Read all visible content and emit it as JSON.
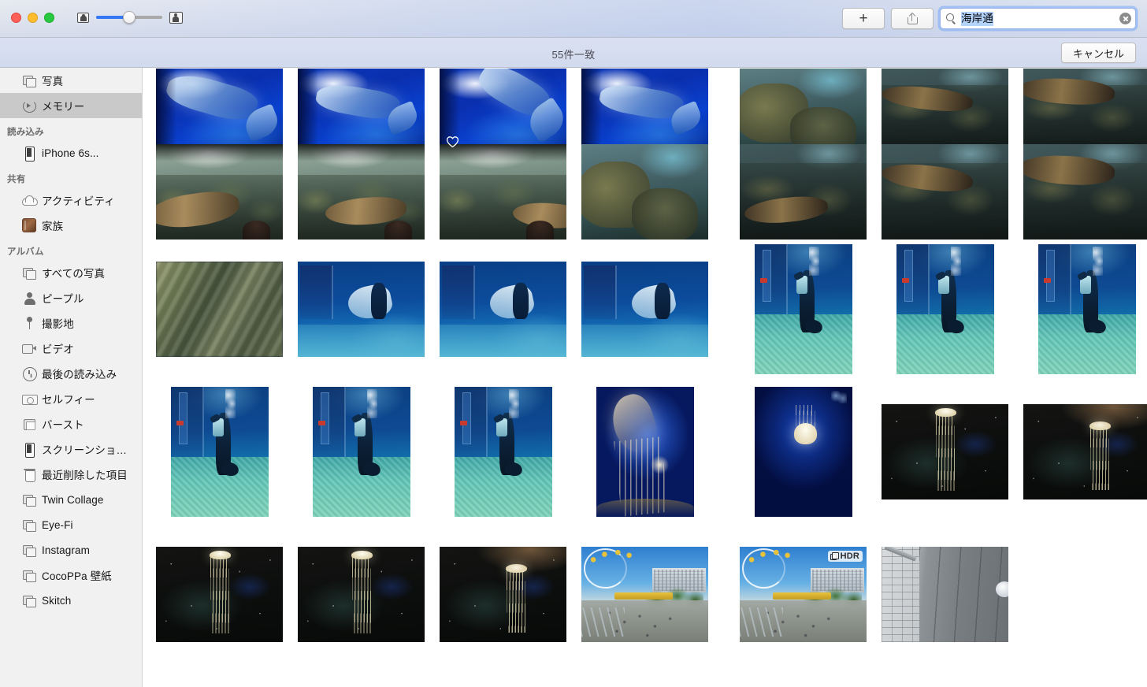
{
  "window": {
    "traffic_lights": [
      "close",
      "minimize",
      "zoom"
    ],
    "zoom_slider": {
      "value_percent": 50,
      "small_icon": "small-thumbnail-icon",
      "large_icon": "large-thumbnail-icon"
    }
  },
  "toolbar": {
    "add_label": "+",
    "add_icon": "plus-icon",
    "share_icon": "share-icon",
    "search": {
      "icon": "search-icon",
      "value": "海岸通",
      "clear_icon": "clear-icon",
      "selected": true
    }
  },
  "subtoolbar": {
    "match_count": "55件一致",
    "cancel_label": "キャンセル"
  },
  "sidebar": {
    "top_items": [
      {
        "label": "写真",
        "icon": "photos-icon",
        "selected": false
      },
      {
        "label": "メモリー",
        "icon": "memories-icon",
        "selected": true
      }
    ],
    "sections": [
      {
        "header": "読み込み",
        "items": [
          {
            "label": "iPhone 6s...",
            "icon": "iphone-icon"
          }
        ]
      },
      {
        "header": "共有",
        "items": [
          {
            "label": "アクティビティ",
            "icon": "cloud-icon"
          },
          {
            "label": "家族",
            "icon": "shared-album-icon"
          }
        ]
      },
      {
        "header": "アルバム",
        "items": [
          {
            "label": "すべての写真",
            "icon": "photos-icon"
          },
          {
            "label": "ピープル",
            "icon": "person-icon"
          },
          {
            "label": "撮影地",
            "icon": "location-pin-icon"
          },
          {
            "label": "ビデオ",
            "icon": "video-icon"
          },
          {
            "label": "最後の読み込み",
            "icon": "clock-icon"
          },
          {
            "label": "セルフィー",
            "icon": "camera-icon"
          },
          {
            "label": "バースト",
            "icon": "burst-icon"
          },
          {
            "label": "スクリーンショ…",
            "icon": "iphone-icon"
          },
          {
            "label": "最近削除した項目",
            "icon": "trash-icon"
          },
          {
            "label": "Twin Collage",
            "icon": "album-icon"
          },
          {
            "label": "Eye-Fi",
            "icon": "album-icon"
          },
          {
            "label": "Instagram",
            "icon": "album-icon"
          },
          {
            "label": "CocoPPa 壁紙",
            "icon": "album-icon"
          },
          {
            "label": "Skitch",
            "icon": "album-icon"
          }
        ]
      }
    ]
  },
  "grid": {
    "rows": [
      {
        "row_index": 0,
        "cells": [
          {
            "subject": "whale-shark",
            "style": "ph-whale",
            "orientation": "landscape",
            "badges": []
          },
          {
            "subject": "whale-shark",
            "style": "ph-whale ph-whale2",
            "orientation": "landscape",
            "badges": []
          },
          {
            "subject": "whale-shark",
            "style": "ph-whale ph-whale3",
            "orientation": "landscape",
            "badges": [
              "favorite"
            ]
          },
          {
            "subject": "whale-shark",
            "style": "ph-whale ph-whale2",
            "orientation": "landscape",
            "badges": []
          },
          {
            "subject": "reef",
            "style": "ph-reef",
            "orientation": "landscape",
            "badges": []
          },
          {
            "subject": "sea-lion",
            "style": "ph-sealion-dark v2",
            "orientation": "landscape",
            "badges": []
          },
          {
            "subject": "sea-lion",
            "style": "ph-sealion-dark v3",
            "orientation": "landscape",
            "badges": []
          }
        ]
      },
      {
        "row_index": 1,
        "cells": [
          {
            "subject": "sea-lion",
            "style": "ph-sealion",
            "orientation": "landscape",
            "badges": []
          },
          {
            "subject": "sea-lion",
            "style": "ph-sealion ph-sealion2",
            "orientation": "landscape",
            "badges": []
          },
          {
            "subject": "sea-lion",
            "style": "ph-sealion ph-sealion3",
            "orientation": "landscape",
            "badges": []
          },
          {
            "subject": "reef",
            "style": "ph-reef",
            "orientation": "landscape",
            "badges": []
          },
          {
            "subject": "sea-lion",
            "style": "ph-sealion-dark",
            "orientation": "landscape",
            "badges": []
          },
          {
            "subject": "sea-lion",
            "style": "ph-sealion-dark v2",
            "orientation": "landscape",
            "badges": []
          },
          {
            "subject": "sea-lion",
            "style": "ph-sealion-dark v3",
            "orientation": "landscape",
            "badges": []
          }
        ]
      },
      {
        "row_index": 2,
        "cells": [
          {
            "subject": "blurred-rocks",
            "style": "ph-blur",
            "orientation": "landscape",
            "badges": []
          },
          {
            "subject": "manta-ray",
            "style": "ph-ray",
            "orientation": "landscape",
            "badges": []
          },
          {
            "subject": "manta-ray",
            "style": "ph-ray",
            "orientation": "landscape",
            "badges": []
          },
          {
            "subject": "manta-ray",
            "style": "ph-ray",
            "orientation": "landscape",
            "badges": []
          },
          {
            "subject": "scuba-diver",
            "style": "ph-diver",
            "orientation": "portrait",
            "badges": []
          },
          {
            "subject": "scuba-diver",
            "style": "ph-diver",
            "orientation": "portrait",
            "badges": []
          },
          {
            "subject": "scuba-diver",
            "style": "ph-diver",
            "orientation": "portrait",
            "badges": []
          }
        ]
      },
      {
        "row_index": 3,
        "cells": [
          {
            "subject": "scuba-diver",
            "style": "ph-diver",
            "orientation": "portrait",
            "badges": []
          },
          {
            "subject": "scuba-diver",
            "style": "ph-diver",
            "orientation": "portrait",
            "badges": []
          },
          {
            "subject": "scuba-diver",
            "style": "ph-diver",
            "orientation": "portrait",
            "badges": []
          },
          {
            "subject": "jellyfish",
            "style": "ph-jelly1",
            "orientation": "portrait",
            "badges": []
          },
          {
            "subject": "jellyfish",
            "style": "ph-jelly2",
            "orientation": "portrait",
            "badges": []
          },
          {
            "subject": "jellyfish",
            "style": "ph-jellydark",
            "orientation": "landscape",
            "badges": []
          },
          {
            "subject": "jellyfish",
            "style": "ph-jellydark v3",
            "orientation": "landscape",
            "badges": []
          }
        ]
      },
      {
        "row_index": 4,
        "cells": [
          {
            "subject": "jellyfish",
            "style": "ph-jellydark",
            "orientation": "landscape",
            "badges": []
          },
          {
            "subject": "jellyfish",
            "style": "ph-jellydark",
            "orientation": "landscape",
            "badges": []
          },
          {
            "subject": "jellyfish",
            "style": "ph-jellydark v3",
            "orientation": "landscape",
            "badges": []
          },
          {
            "subject": "amusement-park",
            "style": "ph-park",
            "orientation": "landscape",
            "badges": []
          },
          {
            "subject": "amusement-park",
            "style": "ph-park",
            "orientation": "landscape",
            "badges": [
              "hdr"
            ]
          },
          {
            "subject": "stone-wall",
            "style": "ph-wall",
            "orientation": "landscape",
            "badges": []
          }
        ]
      }
    ],
    "badges": {
      "hdr_label": "HDR",
      "favorite_icon": "heart-icon",
      "hdr_icon": "hdr-icon"
    }
  },
  "colors": {
    "accent": "#3478f6",
    "sidebar_bg": "#f1f1f1",
    "selection": "#c9c9c9",
    "search_selection": "#b4d3fb"
  }
}
